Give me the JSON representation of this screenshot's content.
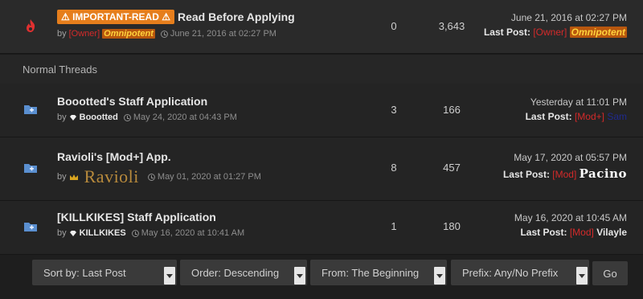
{
  "section_label": "Normal Threads",
  "sticky": {
    "badge": "⚠ IMPORTANT-READ ⚠",
    "title": "Read Before Applying",
    "by": "by",
    "author_rank": "[Owner]",
    "author": "Omnipotent",
    "date": "June 21, 2016 at 02:27 PM",
    "replies": "0",
    "views": "3,643",
    "last_date": "June 21, 2016 at 02:27 PM",
    "last_post_label": "Last Post:",
    "last_rank": "[Owner]",
    "last_user": "Omnipotent"
  },
  "threads": [
    {
      "title": "Boootted's Staff Application",
      "by": "by",
      "author": "Boootted",
      "date": "May 24, 2020 at 04:43 PM",
      "replies": "3",
      "views": "166",
      "last_date": "Yesterday at 11:01 PM",
      "last_post_label": "Last Post:",
      "last_rank": "[Mod+]",
      "last_user": "Sam"
    },
    {
      "title": "Ravioli's [Mod+] App.",
      "by": "by",
      "author": "Ravioli",
      "date": "May 01, 2020 at 01:27 PM",
      "replies": "8",
      "views": "457",
      "last_date": "May 17, 2020 at 05:57 PM",
      "last_post_label": "Last Post:",
      "last_rank": "[Mod]",
      "last_user": "Pacino"
    },
    {
      "title": "[KILLKIKES] Staff Application",
      "by": "by",
      "author": "KILLKIKES",
      "date": "May 16, 2020 at 10:41 AM",
      "replies": "1",
      "views": "180",
      "last_date": "May 16, 2020 at 10:45 AM",
      "last_post_label": "Last Post:",
      "last_rank": "[Mod]",
      "last_user": "Vilayle"
    }
  ],
  "footer": {
    "sort": "Sort by: Last Post",
    "order": "Order: Descending",
    "from": "From: The Beginning",
    "prefix": "Prefix: Any/No Prefix",
    "go": "Go"
  }
}
